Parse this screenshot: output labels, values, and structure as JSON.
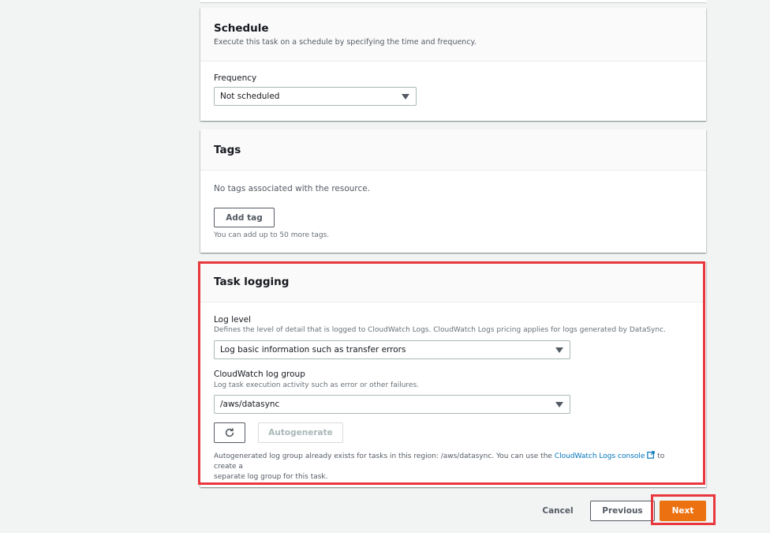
{
  "schedule": {
    "title": "Schedule",
    "description": "Execute this task on a schedule by specifying the time and frequency.",
    "frequency_label": "Frequency",
    "frequency_value": "Not scheduled"
  },
  "tags": {
    "title": "Tags",
    "empty_text": "No tags associated with the resource.",
    "add_tag_label": "Add tag",
    "hint": "You can add up to 50 more tags."
  },
  "task_logging": {
    "title": "Task logging",
    "log_level_label": "Log level",
    "log_level_desc": "Defines the level of detail that is logged to CloudWatch Logs. CloudWatch Logs pricing applies for logs generated by DataSync.",
    "log_level_value": "Log basic information such as transfer errors",
    "log_group_label": "CloudWatch log group",
    "log_group_desc": "Log task execution activity such as error or other failures.",
    "log_group_value": "/aws/datasync",
    "autogenerate_label": "Autogenerate",
    "info_text_1": "Autogenerated log group already exists for tasks in this region: /aws/datasync. You can use the",
    "info_link": "CloudWatch Logs console",
    "info_text_2": "to create a",
    "info_text_3": "separate log group for this task."
  },
  "footer": {
    "cancel_label": "Cancel",
    "previous_label": "Previous",
    "next_label": "Next"
  },
  "colors": {
    "primary": "#ec7211",
    "highlight": "#e8383d",
    "link": "#0073bb"
  },
  "icons": {
    "refresh": "refresh-icon",
    "external": "external-link-icon",
    "caret": "caret-down-icon"
  }
}
